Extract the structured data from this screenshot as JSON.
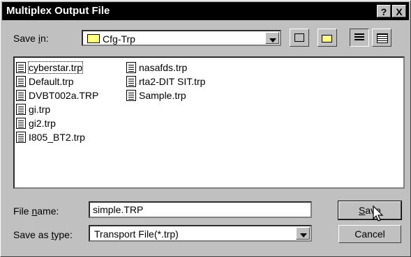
{
  "window": {
    "title": "Multiplex Output File",
    "help_label": "?",
    "close_label": "X"
  },
  "save_in": {
    "label_pre": "Save ",
    "label_u": "i",
    "label_post": "n:",
    "folder": "Cfg-Trp",
    "folder_icon": "folder-icon"
  },
  "toolbar": {
    "up_icon": "up-folder-icon",
    "new_folder_icon": "new-folder-icon",
    "list_icon": "list-view-icon",
    "details_icon": "details-view-icon"
  },
  "files": [
    {
      "name": "cyberstar.trp",
      "selected": true
    },
    {
      "name": "Default.trp"
    },
    {
      "name": "DVBT002a.TRP"
    },
    {
      "name": "gi.trp"
    },
    {
      "name": "gi2.trp"
    },
    {
      "name": "I805_BT2.trp"
    },
    {
      "name": "nasafds.trp"
    },
    {
      "name": "rta2-DIT SIT.trp"
    },
    {
      "name": "Sample.trp"
    }
  ],
  "file_name": {
    "label_pre": "File ",
    "label_u": "n",
    "label_post": "ame:",
    "value": "simple.TRP"
  },
  "save_as_type": {
    "label_pre": "Save as ",
    "label_u": "t",
    "label_post": "ype:",
    "value": "Transport File(*.trp)"
  },
  "buttons": {
    "save_u": "S",
    "save_rest": "ave",
    "cancel": "Cancel"
  }
}
